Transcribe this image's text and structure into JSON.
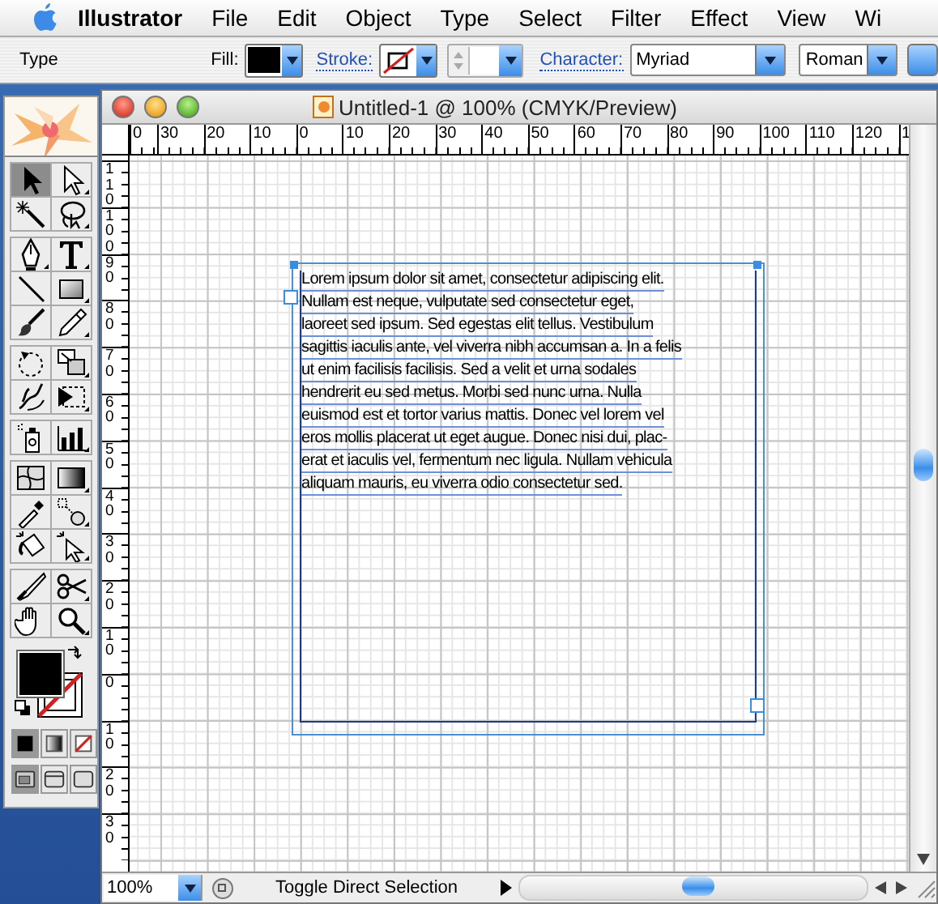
{
  "menu_bar": {
    "app": "Illustrator",
    "items": [
      "File",
      "Edit",
      "Object",
      "Type",
      "Select",
      "Filter",
      "Effect",
      "View",
      "Wi"
    ]
  },
  "control_palette": {
    "mode": "Type",
    "fill_label": "Fill:",
    "stroke_label": "Stroke:",
    "character_label": "Character:",
    "font_family": "Myriad",
    "font_style": "Roman"
  },
  "toolbox": {
    "groups": [
      [
        {
          "kind": "selection",
          "selected": true
        },
        {
          "kind": "direct",
          "selected": false
        },
        {
          "kind": "wand",
          "selected": false
        },
        {
          "kind": "lasso",
          "selected": false
        }
      ],
      [
        {
          "kind": "pen",
          "selected": false
        },
        {
          "kind": "type",
          "selected": false
        },
        {
          "kind": "line",
          "selected": false
        },
        {
          "kind": "rect",
          "selected": false
        },
        {
          "kind": "brush",
          "selected": false
        },
        {
          "kind": "pencil",
          "selected": false
        }
      ],
      [
        {
          "kind": "rotate",
          "selected": false
        },
        {
          "kind": "scale",
          "selected": false
        },
        {
          "kind": "warp",
          "selected": false
        },
        {
          "kind": "transform",
          "selected": false
        }
      ],
      [
        {
          "kind": "spray",
          "selected": false
        },
        {
          "kind": "graph",
          "selected": false
        }
      ],
      [
        {
          "kind": "mesh",
          "selected": false
        },
        {
          "kind": "gradient",
          "selected": false
        },
        {
          "kind": "eyedropper",
          "selected": false
        },
        {
          "kind": "blend",
          "selected": false
        },
        {
          "kind": "bucket",
          "selected": false
        },
        {
          "kind": "paintselect",
          "selected": false
        }
      ],
      [
        {
          "kind": "knife",
          "selected": false
        },
        {
          "kind": "scissors",
          "selected": false
        },
        {
          "kind": "hand",
          "selected": false
        },
        {
          "kind": "zoom",
          "selected": false
        }
      ]
    ],
    "paint_modes": [
      {
        "kind": "color",
        "selected": true
      },
      {
        "kind": "gradient",
        "selected": false
      },
      {
        "kind": "none",
        "selected": false
      }
    ],
    "screen_modes": [
      {
        "kind": "standard",
        "selected": true
      },
      {
        "kind": "full-menu",
        "selected": false
      },
      {
        "kind": "full",
        "selected": false
      }
    ]
  },
  "document": {
    "title": "Untitled-1 @ 100% (CMYK/Preview)",
    "h_ruler": [
      "0",
      "30",
      "20",
      "10",
      "0",
      "10",
      "20",
      "30",
      "40",
      "50",
      "60",
      "70",
      "80",
      "90",
      "100",
      "110",
      "120",
      "1"
    ],
    "v_ruler": [
      "110",
      "100",
      "90",
      "80",
      "70",
      "60",
      "50",
      "40",
      "30",
      "20",
      "10",
      "0",
      "10",
      "20",
      "30"
    ],
    "text_lines": [
      "Lorem ipsum dolor sit amet, consectetur adipiscing elit.",
      "Nullam est neque, vulputate sed consectetur eget,",
      "laoreet sed ipsum. Sed egestas elit tellus. Vestibulum",
      "sagittis iaculis ante, vel viverra nibh accumsan a. In a felis",
      "ut enim facilisis facilisis. Sed a velit et urna sodales",
      "hendrerit eu sed metus. Morbi sed nunc urna. Nulla",
      "euismod est et tortor varius mattis. Donec vel lorem vel",
      "eros mollis placerat ut eget augue. Donec nisi dui, plac-",
      "erat et iaculis vel, fermentum nec ligula. Nullam vehicula",
      "aliquam mauris, eu viverra odio consectetur sed."
    ],
    "zoom": "100%",
    "status": "Toggle Direct Selection"
  }
}
